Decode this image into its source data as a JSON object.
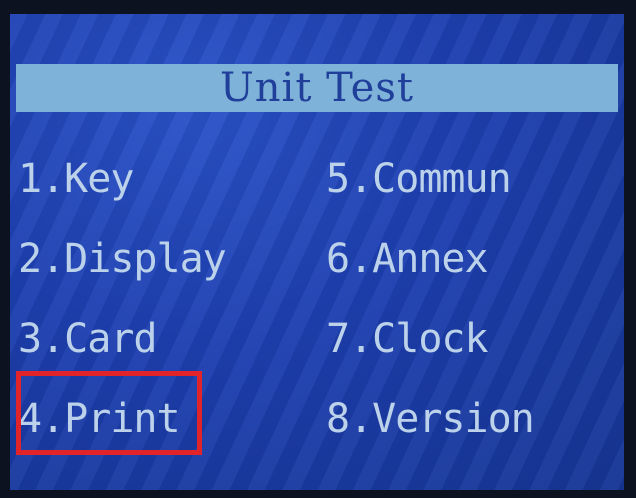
{
  "screen": {
    "title": "Unit Test",
    "menu": {
      "left": [
        {
          "label": "1.Key"
        },
        {
          "label": "2.Display"
        },
        {
          "label": "3.Card"
        },
        {
          "label": "4.Print"
        }
      ],
      "right": [
        {
          "label": "5.Commun"
        },
        {
          "label": "6.Annex"
        },
        {
          "label": "7.Clock"
        },
        {
          "label": "8.Version"
        }
      ]
    },
    "selected_item": "4.Print",
    "colors": {
      "background": "#1d3fb0",
      "title_bar": "#7eb2d8",
      "title_text": "#1f3f9a",
      "menu_text": "#bcd2ea",
      "highlight_border": "#e0242a"
    }
  }
}
